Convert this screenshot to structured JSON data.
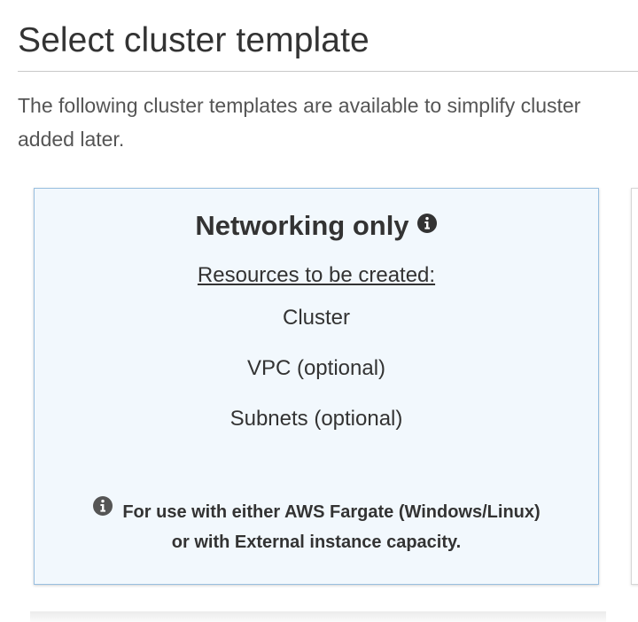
{
  "page": {
    "title": "Select cluster template",
    "intro_line1": "The following cluster templates are available to simplify cluster",
    "intro_line2": "added later."
  },
  "card": {
    "title": "Networking only",
    "resources_heading": "Resources to be created:",
    "resources": [
      "Cluster",
      "VPC (optional)",
      "Subnets (optional)"
    ],
    "note_line1": "For use with either AWS Fargate (Windows/Linux)",
    "note_line2": "or with External instance capacity."
  },
  "icons": {
    "title_info": "info-icon",
    "note_info": "info-icon"
  },
  "colors": {
    "card_background": "#f2f8fd",
    "card_border": "#99bfe0",
    "text": "#333333"
  }
}
